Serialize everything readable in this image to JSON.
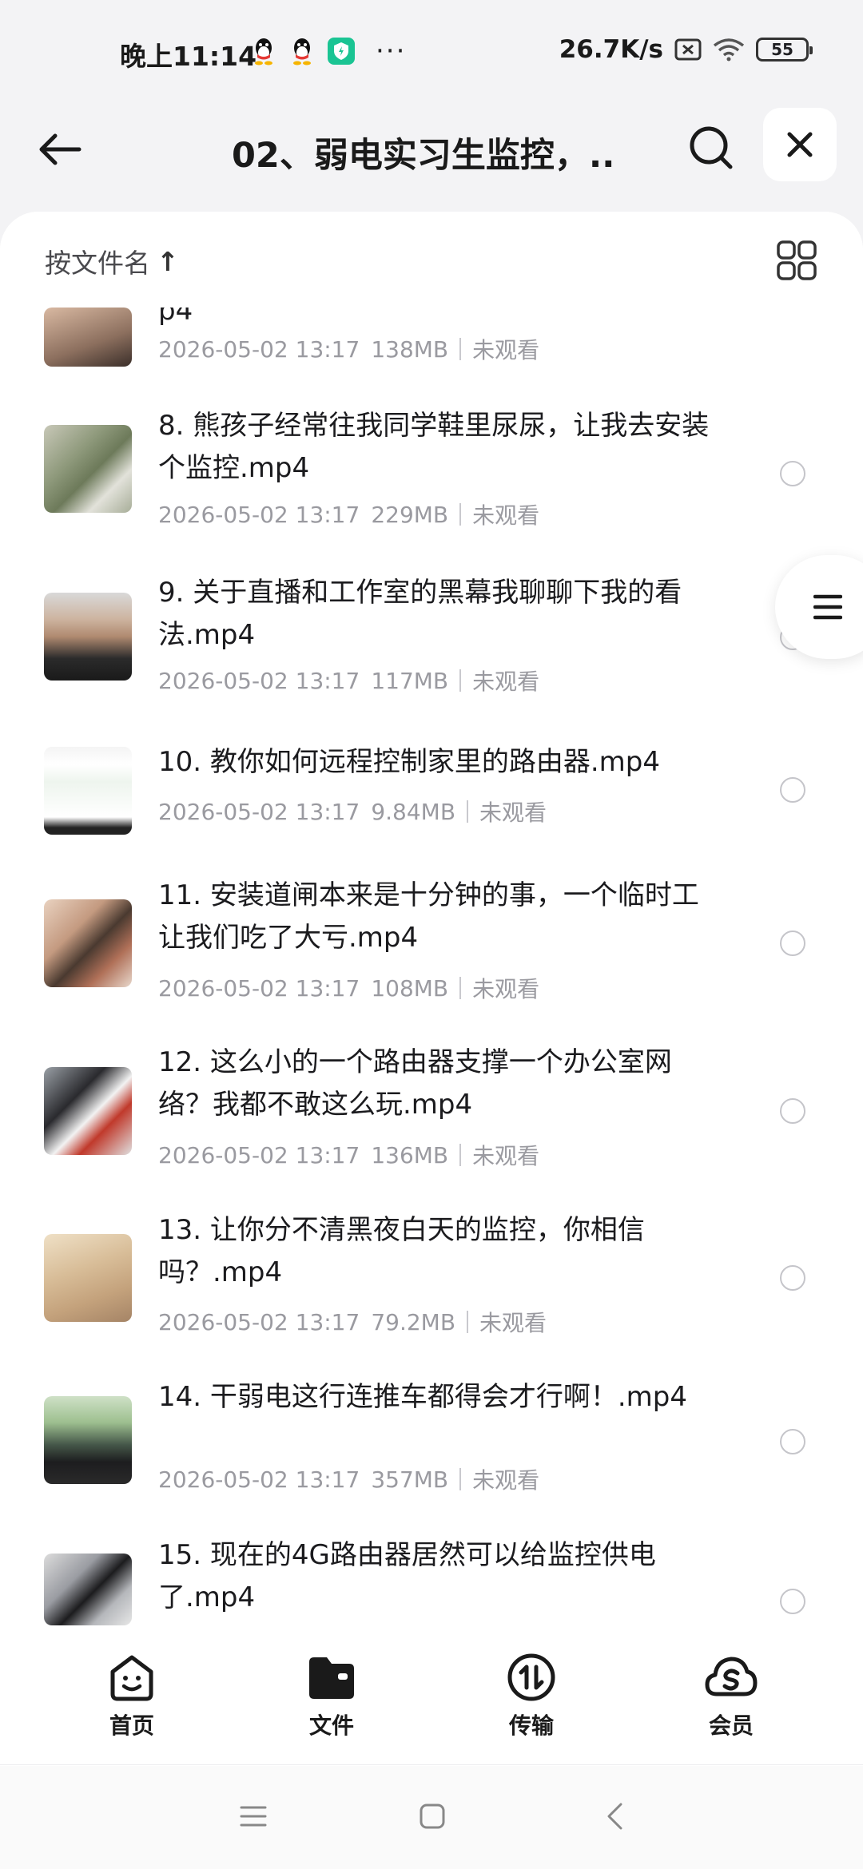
{
  "status_bar": {
    "time": "晚上11:14",
    "more": "···",
    "net_speed": "26.7K/s",
    "battery": "55"
  },
  "header": {
    "title": "02、弱电实习生监控，..."
  },
  "sort": {
    "label": "按文件名",
    "arrow": "↑"
  },
  "files": [
    {
      "name": "p4",
      "date": "2026-05-02 13:17",
      "size": "138MB",
      "status": "未观看",
      "thumb": "hand-face"
    },
    {
      "name": "8. 熊孩子经常往我同学鞋里尿尿，让我去安装个监控.mp4",
      "date": "2026-05-02 13:17",
      "size": "229MB",
      "status": "未观看",
      "thumb": "room"
    },
    {
      "name": "9. 关于直播和工作室的黑幕我聊聊下我的看法.mp4",
      "date": "2026-05-02 13:17",
      "size": "117MB",
      "status": "未观看",
      "thumb": "person"
    },
    {
      "name": "10. 教你如何远程控制家里的路由器.mp4",
      "date": "2026-05-02 13:17",
      "size": "9.84MB",
      "status": "未观看",
      "thumb": "screen"
    },
    {
      "name": "11. 安装道闸本来是十分钟的事，一个临时工让我们吃了大亏.mp4",
      "date": "2026-05-02 13:17",
      "size": "108MB",
      "status": "未观看",
      "thumb": "wires"
    },
    {
      "name": "12. 这么小的一个路由器支撑一个办公室网络？我都不敢这么玩.mp4",
      "date": "2026-05-02 13:17",
      "size": "136MB",
      "status": "未观看",
      "thumb": "router"
    },
    {
      "name": "13. 让你分不清黑夜白天的监控，你相信吗？.mp4",
      "date": "2026-05-02 13:17",
      "size": "79.2MB",
      "status": "未观看",
      "thumb": "sand"
    },
    {
      "name": "14. 干弱电这行连推车都得会才行啊！.mp4",
      "date": "2026-05-02 13:17",
      "size": "357MB",
      "status": "未观看",
      "thumb": "car"
    },
    {
      "name": "15. 现在的4G路由器居然可以给监控供电了.mp4",
      "date": "",
      "size": "",
      "status": "",
      "thumb": "device"
    }
  ],
  "tabs": [
    {
      "label": "首页",
      "icon": "home-face-icon"
    },
    {
      "label": "文件",
      "icon": "folder-icon"
    },
    {
      "label": "传输",
      "icon": "transfer-icon"
    },
    {
      "label": "会员",
      "icon": "vip-cloud-icon"
    }
  ],
  "colors": {
    "background": "#f3f3f5",
    "panel": "#ffffff",
    "meta_text": "#9a9aa0",
    "shield_badge": "#1ac493"
  }
}
